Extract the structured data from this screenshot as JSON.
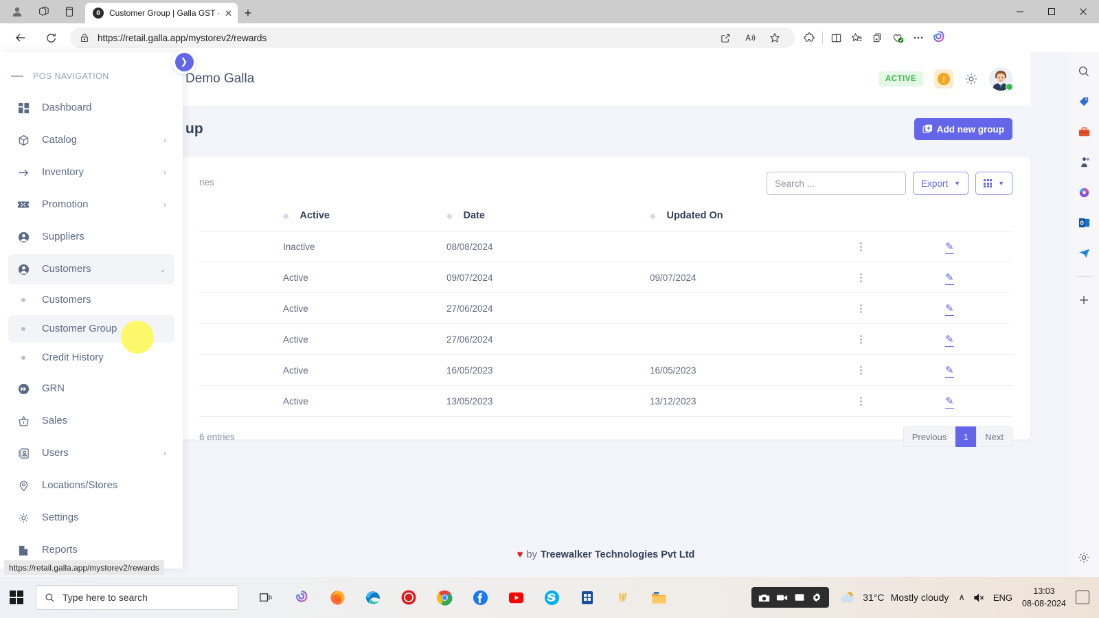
{
  "browser": {
    "tab": {
      "title": "Customer Group | Galla GST - Inv",
      "favicon": "galla-favicon",
      "close": "✕"
    },
    "new_tab": "+",
    "url": "https://retail.galla.app/mystorev2/rewards",
    "window_controls": {
      "minimize": "–",
      "maximize": "❐",
      "close": "✕"
    },
    "status_tooltip": "https://retail.galla.app/mystorev2/rewards"
  },
  "pos_sidebar": {
    "section_label": "POS NAVIGATION",
    "items": [
      {
        "label": "Dashboard",
        "icon": "dashboard-icon",
        "expandable": false
      },
      {
        "label": "Catalog",
        "icon": "box-icon",
        "expandable": true
      },
      {
        "label": "Inventory",
        "icon": "arrow-right-icon",
        "expandable": true
      },
      {
        "label": "Promotion",
        "icon": "percent-tag-icon",
        "expandable": true
      },
      {
        "label": "Suppliers",
        "icon": "user-circle-icon",
        "expandable": false
      },
      {
        "label": "Customers",
        "icon": "user-circle-icon",
        "expandable": true,
        "active": true
      }
    ],
    "sub_items": [
      {
        "label": "Customers",
        "active": false
      },
      {
        "label": "Customer Group",
        "active": true
      },
      {
        "label": "Credit History",
        "active": false
      }
    ],
    "items_after": [
      {
        "label": "GRN",
        "icon": "fast-forward-icon",
        "expandable": false
      },
      {
        "label": "Sales",
        "icon": "basket-icon",
        "expandable": false
      },
      {
        "label": "Users",
        "icon": "users-card-icon",
        "expandable": true
      },
      {
        "label": "Locations/Stores",
        "icon": "map-pin-icon",
        "expandable": false
      },
      {
        "label": "Settings",
        "icon": "gear-icon",
        "expandable": false
      },
      {
        "label": "Reports",
        "icon": "report-icon",
        "expandable": false
      }
    ]
  },
  "app_header": {
    "store_name": "Demo Galla",
    "status_badge": "ACTIVE",
    "status_badge_color": "#3cb44a",
    "warning_icon": "alert-icon",
    "settings_icon": "gear-icon",
    "avatar": "user-avatar"
  },
  "page": {
    "heading": "up",
    "add_button": "Add new group",
    "add_button_color": "#6366e8"
  },
  "table_card": {
    "entries_label": "ries",
    "search_placeholder": "Search ...",
    "export_label": "Export",
    "columns_icon": "grid-icon",
    "caret": "▼",
    "columns": [
      "",
      "Active",
      "Date",
      "Updated On",
      "",
      ""
    ],
    "rows": [
      {
        "active": "Inactive",
        "date": "08/08/2024",
        "updated_on": "",
        "menu": "kebab-icon",
        "edit": "pencil-icon"
      },
      {
        "active": "Active",
        "date": "09/07/2024",
        "updated_on": "09/07/2024",
        "menu": "kebab-icon",
        "edit": "pencil-icon"
      },
      {
        "active": "Active",
        "date": "27/06/2024",
        "updated_on": "",
        "menu": "kebab-icon",
        "edit": "pencil-icon"
      },
      {
        "active": "Active",
        "date": "27/06/2024",
        "updated_on": "",
        "menu": "kebab-icon",
        "edit": "pencil-icon"
      },
      {
        "active": "Active",
        "date": "16/05/2023",
        "updated_on": "16/05/2023",
        "menu": "kebab-icon",
        "edit": "pencil-icon"
      },
      {
        "active": "Active",
        "date": "13/05/2023",
        "updated_on": "13/12/2023",
        "menu": "kebab-icon",
        "edit": "pencil-icon"
      }
    ],
    "footer_entries": "6 entries",
    "pagination": {
      "previous": "Previous",
      "current": "1",
      "next": "Next"
    }
  },
  "page_footer": {
    "heart": "♥",
    "by": "by",
    "company": "Treewalker Technologies Pvt Ltd"
  },
  "taskbar": {
    "search_placeholder": "Type here to search",
    "weather_temp": "31°C",
    "weather_desc": "Mostly cloudy",
    "language": "ENG",
    "time": "13:03",
    "date": "08-08-2024",
    "chevron_up": "∧",
    "volume_muted": "⧸"
  }
}
